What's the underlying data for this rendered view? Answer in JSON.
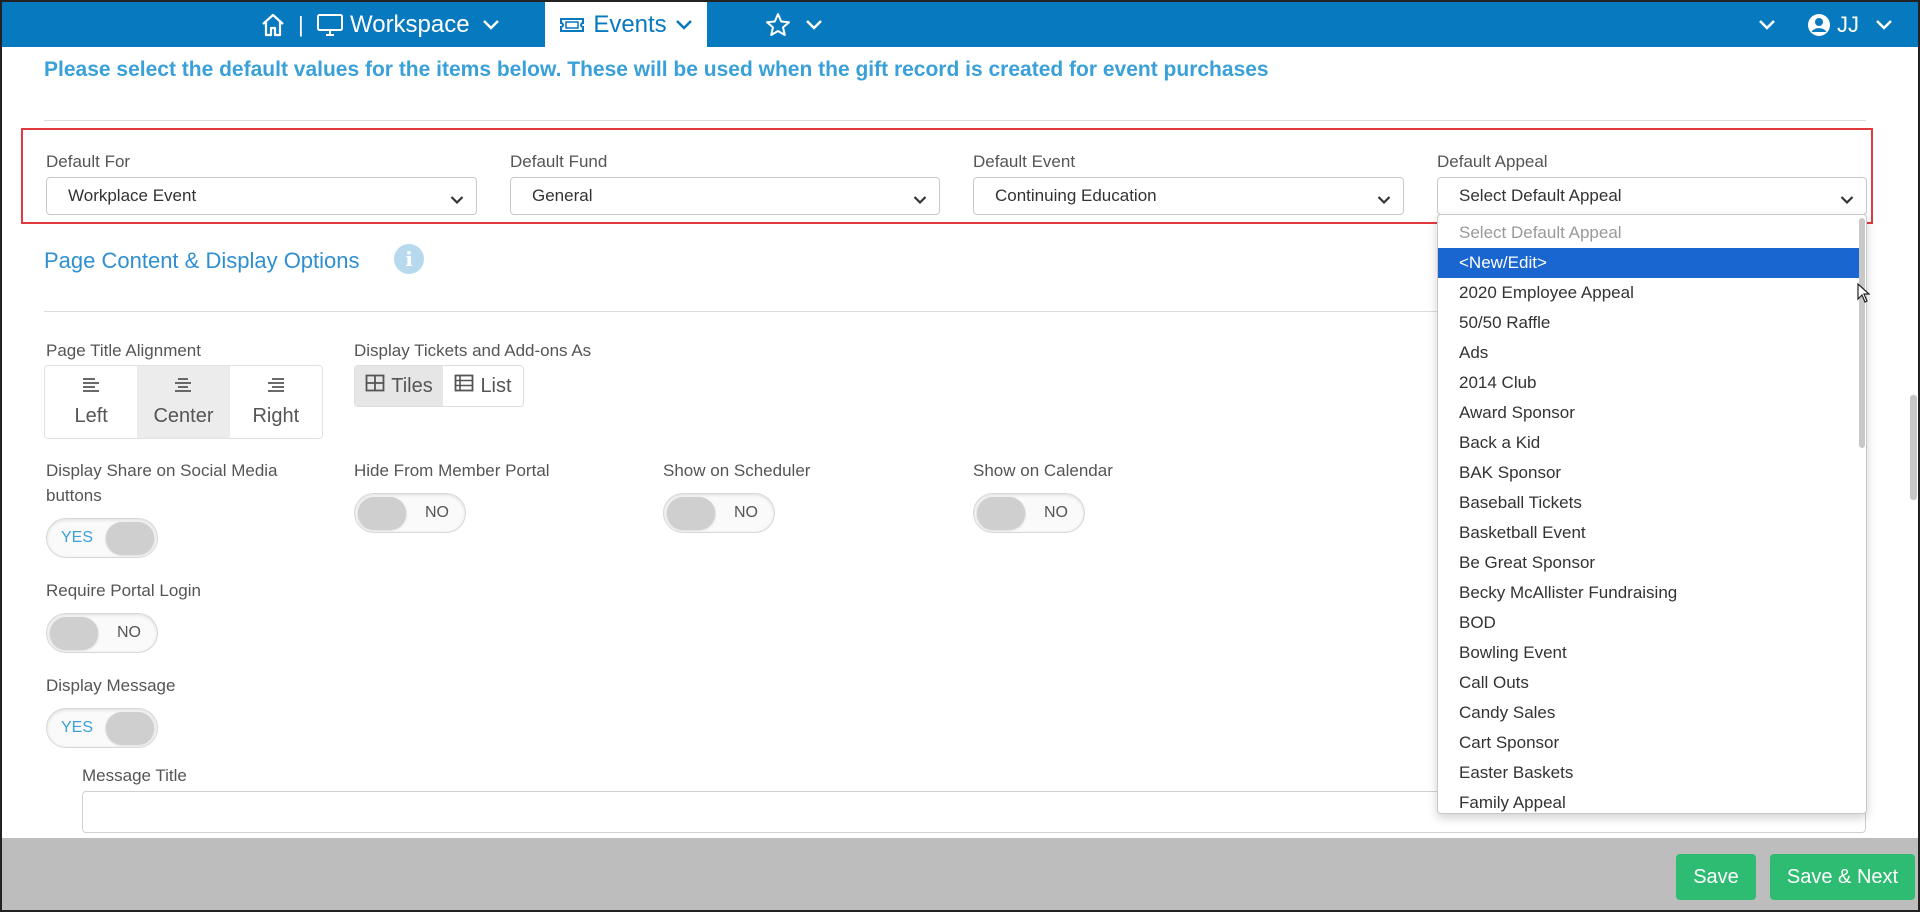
{
  "topbar": {
    "workspace_label": "Workspace",
    "events_label": "Events",
    "separator": "|",
    "user_initials": "JJ"
  },
  "heading": "Please select the default values for the items below. These will be used when the gift record is created for event purchases",
  "defaults": {
    "default_for": {
      "label": "Default For",
      "value": "Workplace Event"
    },
    "default_fund": {
      "label": "Default Fund",
      "value": "General"
    },
    "default_event": {
      "label": "Default Event",
      "value": "Continuing Education"
    },
    "default_appeal": {
      "label": "Default Appeal",
      "value": "Select Default Appeal"
    }
  },
  "section_title": "Page Content & Display Options",
  "info_glyph": "i",
  "page_title_alignment": {
    "label": "Page Title Alignment",
    "options": [
      "Left",
      "Center",
      "Right"
    ],
    "selected": "Center"
  },
  "display_tickets": {
    "label": "Display Tickets and Add-ons As",
    "options": [
      "Tiles",
      "List"
    ],
    "selected": "Tiles"
  },
  "toggles": {
    "share_social": {
      "label_line1": "Display Share on Social Media",
      "label_line2": "buttons",
      "value": "YES"
    },
    "hide_member_portal": {
      "label": "Hide From Member Portal",
      "value": "NO"
    },
    "show_scheduler": {
      "label": "Show on Scheduler",
      "value": "NO"
    },
    "show_calendar": {
      "label": "Show on Calendar",
      "value": "NO"
    },
    "require_portal_login": {
      "label": "Require Portal Login",
      "value": "NO"
    },
    "display_message": {
      "label": "Display Message",
      "value": "YES"
    }
  },
  "message_title": {
    "label": "Message Title",
    "value": ""
  },
  "footer": {
    "save_label": "Save",
    "save_next_label": "Save & Next"
  },
  "appeal_dropdown": {
    "options": [
      "Select Default Appeal",
      "<New/Edit>",
      "2020 Employee Appeal",
      "50/50 Raffle",
      "Ads",
      "2014 Club",
      "Award Sponsor",
      "Back a Kid",
      "BAK Sponsor",
      "Baseball Tickets",
      "Basketball Event",
      "Be Great Sponsor",
      "Becky McAllister Fundraising",
      "BOD",
      "Bowling Event",
      "Call Outs",
      "Candy Sales",
      "Cart Sponsor",
      "Easter Baskets",
      "Family Appeal"
    ],
    "highlighted": "<New/Edit>"
  },
  "colors": {
    "topbar": "#0779bf",
    "accent_text": "#3aa0d8",
    "highlight": "#1a66d1",
    "save_green": "#2ebc72",
    "outline_red": "#e0393e"
  }
}
